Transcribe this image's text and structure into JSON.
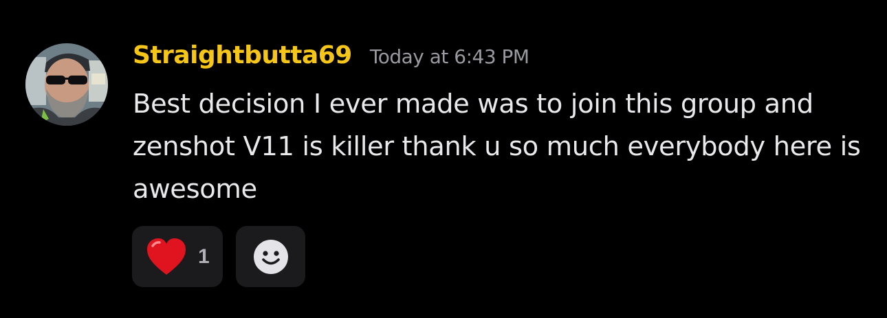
{
  "message": {
    "author": {
      "name": "Straightbutta69",
      "name_color": "#f5c518"
    },
    "timestamp": "Today at 6:43 PM",
    "content": "Best decision I ever made was to join this group and zenshot V11 is killer thank u so much everybody here is awesome",
    "reactions": [
      {
        "emoji": "red-heart-icon",
        "count": "1"
      }
    ],
    "add_reaction_icon": "smiley-icon"
  }
}
